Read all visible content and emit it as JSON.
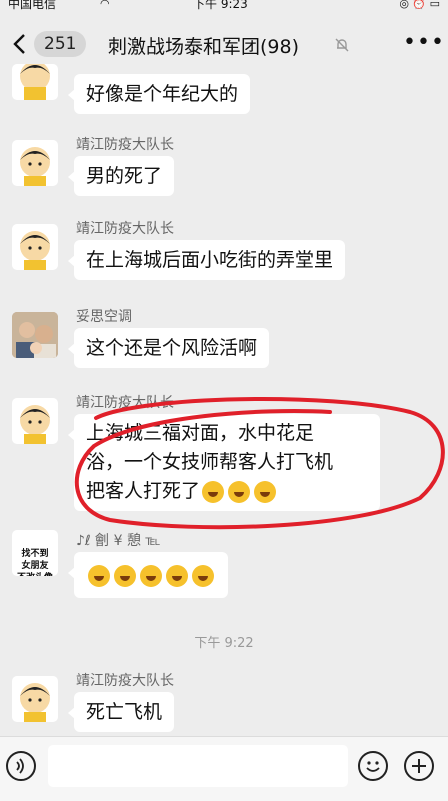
{
  "status_bar": {
    "carrier": "中国电信",
    "time": "下午 9:23"
  },
  "nav": {
    "back_count": "251",
    "title": "刺激战场泰和军团(98)"
  },
  "messages": [
    {
      "sender": "",
      "text": "好像是个年纪大的",
      "avatar": "boy-avatar"
    },
    {
      "sender": "靖江防疫大队长",
      "text": "男的死了",
      "avatar": "boy-avatar"
    },
    {
      "sender": "靖江防疫大队长",
      "text": "在上海城后面小吃街的弄堂里",
      "avatar": "boy-avatar"
    },
    {
      "sender": "妥思空调",
      "text": "这个还是个风险活啊",
      "avatar": "photo-avatar"
    },
    {
      "sender": "靖江防疫大队长",
      "text_line1": "上海城三福对面，水中花足",
      "text_line2": "浴，一个女技师帮客人打飞机",
      "text_line3": "把客人打死了",
      "emoji_count": 3,
      "avatar": "boy-avatar"
    },
    {
      "sender": "♪ℓ 劊 ¥ 憩 ℡",
      "emoji_count": 5,
      "avatar_text": "找不到\n女朋友\n不改头像"
    },
    {
      "sender": "靖江防疫大队长",
      "text": "死亡飞机",
      "avatar": "boy-avatar"
    }
  ],
  "time_separator": "下午 9:22",
  "colors": {
    "background": "#ededed",
    "bubble": "#ffffff",
    "annotation": "#e0202a"
  }
}
